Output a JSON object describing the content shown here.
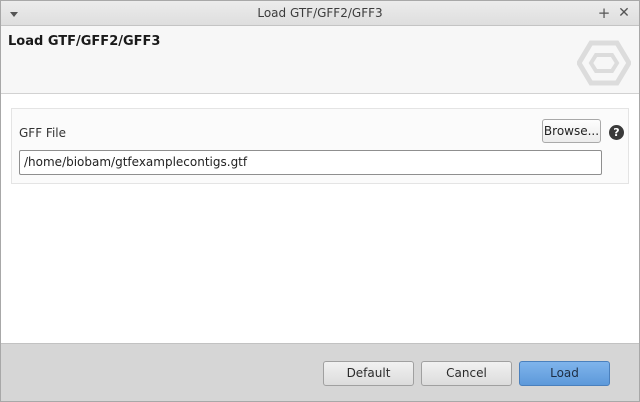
{
  "window": {
    "title": "Load GTF/GFF2/GFF3"
  },
  "header": {
    "heading": "Load GTF/GFF2/GFF3",
    "logo_icon": "hexagon-logo-icon"
  },
  "form": {
    "file_label": "GFF File",
    "browse_label": "Browse...",
    "help_glyph": "?",
    "file_path": "/home/biobam/gtfexamplecontigs.gtf"
  },
  "footer": {
    "default_label": "Default",
    "cancel_label": "Cancel",
    "load_label": "Load"
  },
  "colors": {
    "primary_button": "#6ea7e4",
    "footer_bg": "#d6d6d6",
    "header_bg": "#f7f7f7"
  }
}
